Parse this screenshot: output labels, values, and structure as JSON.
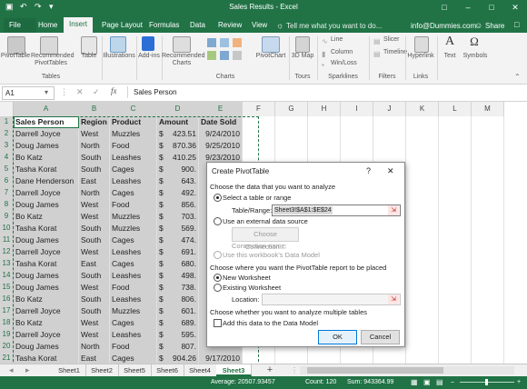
{
  "window": {
    "title": "Sales Results - Excel",
    "qa_save": "▣",
    "qa_undo": "↶",
    "qa_redo": "↷",
    "qa_more": "▾",
    "win_ribbon": "□",
    "win_min": "–",
    "win_max": "□",
    "win_close": "✕"
  },
  "menu": {
    "file": "File",
    "tabs": [
      "Home",
      "Insert",
      "Page Layout",
      "Formulas",
      "Data",
      "Review",
      "View"
    ],
    "active_tab": "Insert",
    "tell_me": "Tell me what you want to do...",
    "account": "info@Dummies.com",
    "share": "Share"
  },
  "ribbon": {
    "pivottable": "PivotTable",
    "recommended_pivottables": "Recommended PivotTables",
    "table": "Table",
    "tables_group": "Tables",
    "illustrations": "Illustrations",
    "addins": "Add-ins",
    "recommended_charts": "Recommended Charts",
    "pivotchart": "PivotChart",
    "charts_group": "Charts",
    "map_3d": "3D Map",
    "tours_group": "Tours",
    "line": "Line",
    "column": "Column",
    "win_loss": "Win/Loss",
    "sparklines_group": "Sparklines",
    "slicer": "Slicer",
    "timeline": "Timeline",
    "filters_group": "Filters",
    "hyperlink": "Hyperlink",
    "links_group": "Links",
    "text": "Text",
    "symbols": "Symbols"
  },
  "formula_bar": {
    "name_box": "A1",
    "fx": "fx",
    "value": "Sales Person"
  },
  "grid": {
    "columns": [
      "A",
      "B",
      "C",
      "D",
      "E",
      "F",
      "G",
      "H",
      "I",
      "J",
      "K",
      "L",
      "M"
    ],
    "row_numbers": [
      "1",
      "2",
      "3",
      "4",
      "5",
      "6",
      "7",
      "8",
      "9",
      "10",
      "11",
      "12",
      "13",
      "14",
      "15",
      "16",
      "17",
      "18",
      "19",
      "20",
      "21",
      "22",
      "23"
    ],
    "headers": [
      "Sales Person",
      "Region",
      "Product",
      "Amount",
      "Date Sold"
    ],
    "currency": "$",
    "rows": [
      [
        "Darrell Joyce",
        "West",
        "Muzzles",
        "423.51",
        "9/24/2010"
      ],
      [
        "Doug James",
        "North",
        "Food",
        "870.36",
        "9/25/2010"
      ],
      [
        "Bo Katz",
        "South",
        "Leashes",
        "410.25",
        "9/23/2010"
      ],
      [
        "Tasha Korat",
        "South",
        "Cages",
        "900.",
        ""
      ],
      [
        "Dane Henderson",
        "East",
        "Leashes",
        "643.",
        ""
      ],
      [
        "Darrell Joyce",
        "North",
        "Cages",
        "492.",
        ""
      ],
      [
        "Doug James",
        "West",
        "Food",
        "856.",
        ""
      ],
      [
        "Bo Katz",
        "West",
        "Muzzles",
        "703.",
        ""
      ],
      [
        "Tasha Korat",
        "South",
        "Muzzles",
        "569.",
        ""
      ],
      [
        "Doug James",
        "South",
        "Cages",
        "474.",
        ""
      ],
      [
        "Darrell Joyce",
        "West",
        "Leashes",
        "691.",
        ""
      ],
      [
        "Tasha Korat",
        "East",
        "Cages",
        "680.",
        ""
      ],
      [
        "Doug James",
        "South",
        "Leashes",
        "498.",
        ""
      ],
      [
        "Doug James",
        "West",
        "Food",
        "738.",
        ""
      ],
      [
        "Bo Katz",
        "South",
        "Leashes",
        "806.",
        ""
      ],
      [
        "Darrell Joyce",
        "South",
        "Muzzles",
        "601.",
        ""
      ],
      [
        "Bo Katz",
        "West",
        "Cages",
        "689.",
        ""
      ],
      [
        "Darrell Joyce",
        "West",
        "Leashes",
        "595.",
        ""
      ],
      [
        "Doug James",
        "North",
        "Food",
        "807.",
        ""
      ],
      [
        "Tasha Korat",
        "East",
        "Cages",
        "904.26",
        "9/17/2010"
      ],
      [
        "Bo Katz",
        "East",
        "Leashes",
        "543.92",
        "9/18/2010"
      ],
      [
        "Doug James",
        "East",
        "Muzzles",
        "493.29",
        "9/17/2010"
      ]
    ]
  },
  "dialog": {
    "title": "Create PivotTable",
    "help": "?",
    "close": "✕",
    "section1": "Choose the data that you want to analyze",
    "select_table": "Select a table or range",
    "table_range_label": "Table/Range:",
    "table_range_value": "Sheet3!$A$1:$E$24",
    "external": "Use an external data source",
    "choose_connection": "Choose Connection...",
    "connection_name": "Connection name:",
    "data_model": "Use this workbook's Data Model",
    "section2": "Choose where you want the PivotTable report to be placed",
    "new_ws": "New Worksheet",
    "existing_ws": "Existing Worksheet",
    "location_label": "Location:",
    "section3": "Choose whether you want to analyze multiple tables",
    "add_model": "Add this data to the Data Model",
    "ok": "OK",
    "cancel": "Cancel",
    "selected_option": "select_table",
    "selected_destination": "new_ws"
  },
  "sheets": {
    "nav_prev": "◂",
    "nav_next": "▸",
    "tabs": [
      "Sheet1",
      "Sheet2",
      "Sheet5",
      "Sheet6",
      "Sheet4",
      "Sheet3"
    ],
    "active": "Sheet3",
    "add": "+"
  },
  "status": {
    "average": "Average: 20507.93457",
    "count": "Count: 120",
    "sum": "Sum: 943364.99"
  },
  "colors": {
    "brand": "#217346",
    "selection": "#d0d0d0",
    "dialog_accent": "#0078d7"
  }
}
